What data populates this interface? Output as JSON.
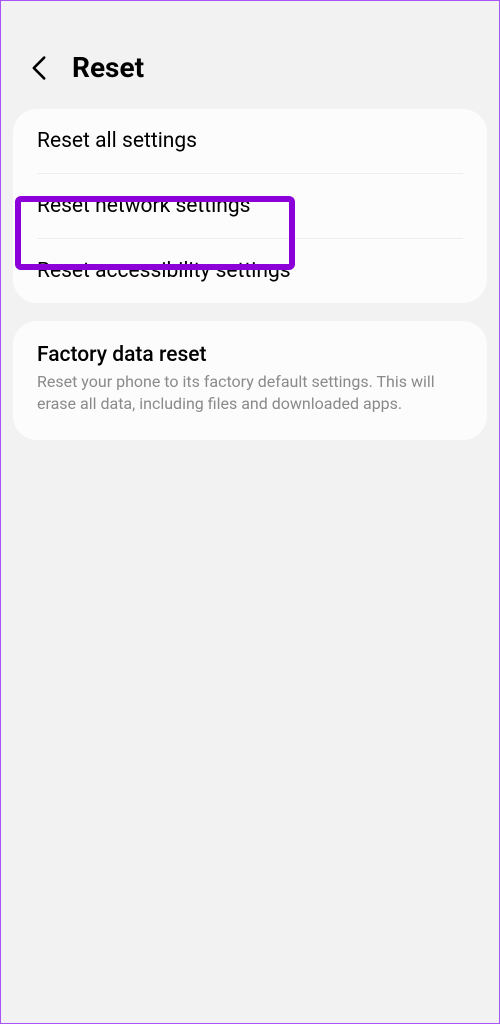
{
  "header": {
    "title": "Reset"
  },
  "group1": {
    "items": [
      {
        "label": "Reset all settings"
      },
      {
        "label": "Reset network settings"
      },
      {
        "label": "Reset accessibility settings"
      }
    ]
  },
  "group2": {
    "title": "Factory data reset",
    "description": "Reset your phone to its factory default settings. This will erase all data, including files and downloaded apps."
  }
}
